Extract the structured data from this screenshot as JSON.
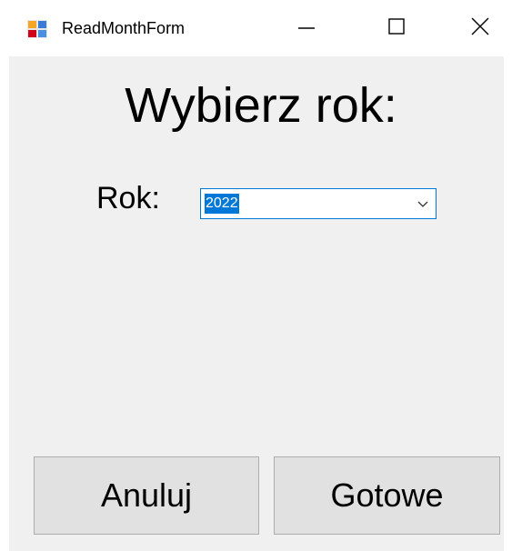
{
  "window": {
    "title": "ReadMonthForm"
  },
  "titlebar": {
    "icons": [
      "app-form-icon",
      "minimize-icon",
      "maximize-icon",
      "close-icon"
    ]
  },
  "form": {
    "heading": "Wybierz rok:",
    "year_label": "Rok:",
    "year_select": {
      "value": "2022",
      "selected": true
    },
    "cancel_label": "Anuluj",
    "done_label": "Gotowe"
  },
  "colors": {
    "client_background": "#f0f0f0",
    "accent": "#0078d7",
    "button_background": "#e1e1e1",
    "button_border": "#adadad"
  }
}
